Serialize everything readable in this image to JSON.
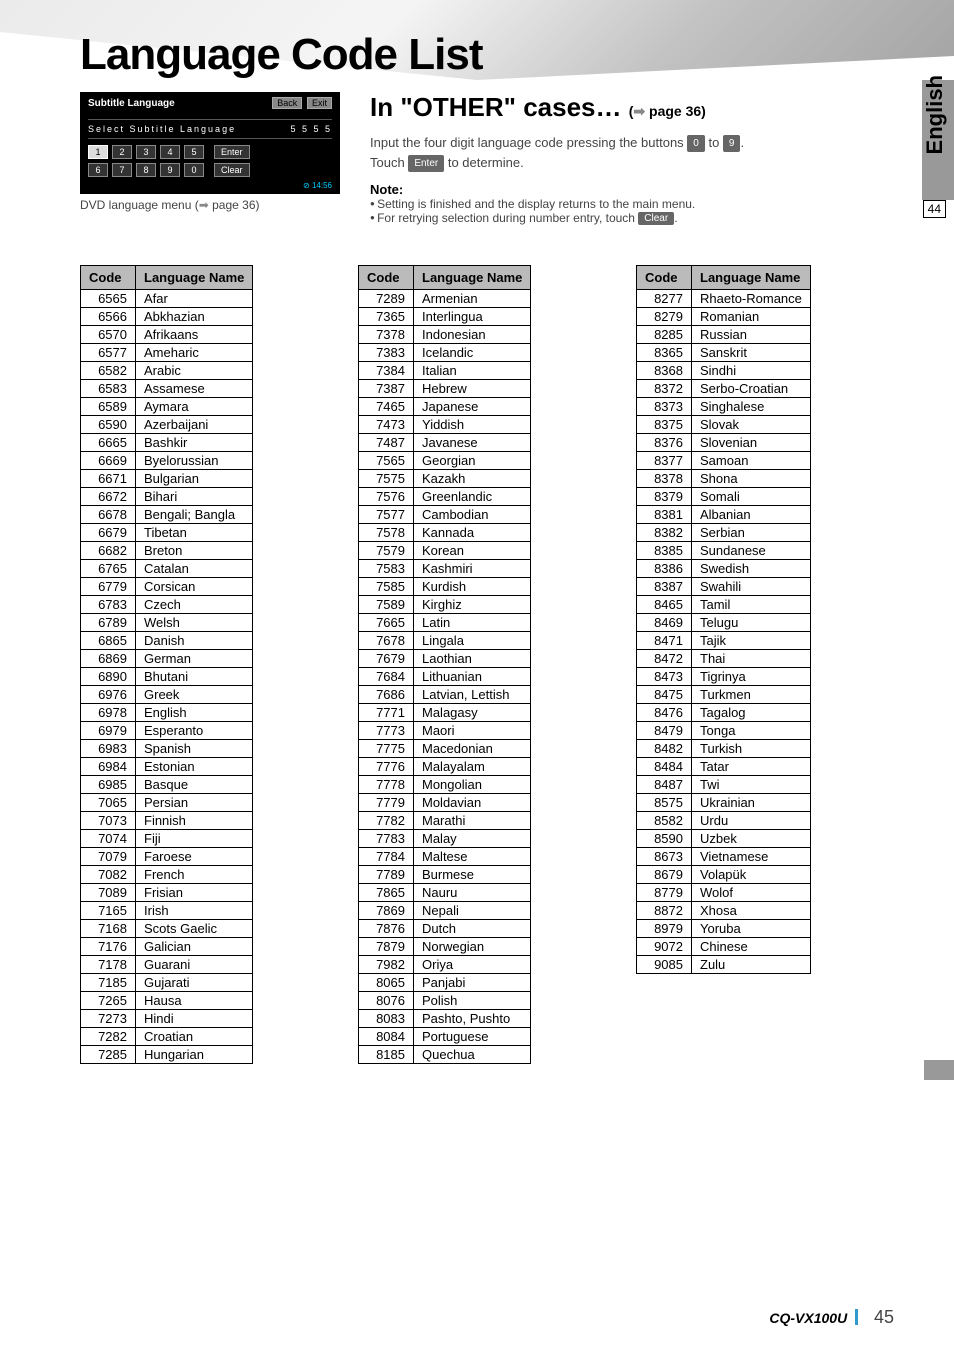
{
  "page_title": "Language Code List",
  "menu": {
    "title": "Subtitle Language",
    "back": "Back",
    "exit": "Exit",
    "select_label": "Select Subtitle Language",
    "display_code": "5 5 5 5",
    "row1": [
      "1",
      "2",
      "3",
      "4",
      "5"
    ],
    "row2": [
      "6",
      "7",
      "8",
      "9",
      "0"
    ],
    "enter": "Enter",
    "clear": "Clear",
    "clock": "⊘ 14:56"
  },
  "menu_caption_prefix": "DVD language menu (",
  "menu_caption_arrow": "➡",
  "menu_caption_suffix": " page 36)",
  "section": {
    "title_prefix": "In \"OTHER\" cases…",
    "page_ref_arrow": "➡",
    "page_ref": " page 36)",
    "line1_a": "Input the four digit language code pressing the buttons ",
    "btn0": "0",
    "line1_b": " to ",
    "btn9": "9",
    "line1_c": ".",
    "line2_a": "Touch ",
    "btn_enter": "Enter",
    "line2_b": " to determine.",
    "note_label": "Note:",
    "note1": "Setting is finished and the display returns to the main menu.",
    "note2_a": "For retrying selection during number entry, touch ",
    "btn_clear": "Clear",
    "note2_b": "."
  },
  "right_lang": "English",
  "right_page": "44",
  "headers": {
    "code": "Code",
    "name": "Language Name"
  },
  "table1": [
    [
      "6565",
      "Afar"
    ],
    [
      "6566",
      "Abkhazian"
    ],
    [
      "6570",
      "Afrikaans"
    ],
    [
      "6577",
      "Ameharic"
    ],
    [
      "6582",
      "Arabic"
    ],
    [
      "6583",
      "Assamese"
    ],
    [
      "6589",
      "Aymara"
    ],
    [
      "6590",
      "Azerbaijani"
    ],
    [
      "6665",
      "Bashkir"
    ],
    [
      "6669",
      "Byelorussian"
    ],
    [
      "6671",
      "Bulgarian"
    ],
    [
      "6672",
      "Bihari"
    ],
    [
      "6678",
      "Bengali; Bangla"
    ],
    [
      "6679",
      "Tibetan"
    ],
    [
      "6682",
      "Breton"
    ],
    [
      "6765",
      "Catalan"
    ],
    [
      "6779",
      "Corsican"
    ],
    [
      "6783",
      "Czech"
    ],
    [
      "6789",
      "Welsh"
    ],
    [
      "6865",
      "Danish"
    ],
    [
      "6869",
      "German"
    ],
    [
      "6890",
      "Bhutani"
    ],
    [
      "6976",
      "Greek"
    ],
    [
      "6978",
      "English"
    ],
    [
      "6979",
      "Esperanto"
    ],
    [
      "6983",
      "Spanish"
    ],
    [
      "6984",
      "Estonian"
    ],
    [
      "6985",
      "Basque"
    ],
    [
      "7065",
      "Persian"
    ],
    [
      "7073",
      "Finnish"
    ],
    [
      "7074",
      "Fiji"
    ],
    [
      "7079",
      "Faroese"
    ],
    [
      "7082",
      "French"
    ],
    [
      "7089",
      "Frisian"
    ],
    [
      "7165",
      "Irish"
    ],
    [
      "7168",
      "Scots Gaelic"
    ],
    [
      "7176",
      "Galician"
    ],
    [
      "7178",
      "Guarani"
    ],
    [
      "7185",
      "Gujarati"
    ],
    [
      "7265",
      "Hausa"
    ],
    [
      "7273",
      "Hindi"
    ],
    [
      "7282",
      "Croatian"
    ],
    [
      "7285",
      "Hungarian"
    ]
  ],
  "table2": [
    [
      "7289",
      "Armenian"
    ],
    [
      "7365",
      "Interlingua"
    ],
    [
      "7378",
      "Indonesian"
    ],
    [
      "7383",
      "Icelandic"
    ],
    [
      "7384",
      "Italian"
    ],
    [
      "7387",
      "Hebrew"
    ],
    [
      "7465",
      "Japanese"
    ],
    [
      "7473",
      "Yiddish"
    ],
    [
      "7487",
      "Javanese"
    ],
    [
      "7565",
      "Georgian"
    ],
    [
      "7575",
      "Kazakh"
    ],
    [
      "7576",
      "Greenlandic"
    ],
    [
      "7577",
      "Cambodian"
    ],
    [
      "7578",
      "Kannada"
    ],
    [
      "7579",
      "Korean"
    ],
    [
      "7583",
      "Kashmiri"
    ],
    [
      "7585",
      "Kurdish"
    ],
    [
      "7589",
      "Kirghiz"
    ],
    [
      "7665",
      "Latin"
    ],
    [
      "7678",
      "Lingala"
    ],
    [
      "7679",
      "Laothian"
    ],
    [
      "7684",
      "Lithuanian"
    ],
    [
      "7686",
      "Latvian, Lettish"
    ],
    [
      "7771",
      "Malagasy"
    ],
    [
      "7773",
      "Maori"
    ],
    [
      "7775",
      "Macedonian"
    ],
    [
      "7776",
      "Malayalam"
    ],
    [
      "7778",
      "Mongolian"
    ],
    [
      "7779",
      "Moldavian"
    ],
    [
      "7782",
      "Marathi"
    ],
    [
      "7783",
      "Malay"
    ],
    [
      "7784",
      "Maltese"
    ],
    [
      "7789",
      "Burmese"
    ],
    [
      "7865",
      "Nauru"
    ],
    [
      "7869",
      "Nepali"
    ],
    [
      "7876",
      "Dutch"
    ],
    [
      "7879",
      "Norwegian"
    ],
    [
      "7982",
      "Oriya"
    ],
    [
      "8065",
      "Panjabi"
    ],
    [
      "8076",
      "Polish"
    ],
    [
      "8083",
      "Pashto, Pushto"
    ],
    [
      "8084",
      "Portuguese"
    ],
    [
      "8185",
      "Quechua"
    ]
  ],
  "table3": [
    [
      "8277",
      "Rhaeto-Romance"
    ],
    [
      "8279",
      "Romanian"
    ],
    [
      "8285",
      "Russian"
    ],
    [
      "8365",
      "Sanskrit"
    ],
    [
      "8368",
      "Sindhi"
    ],
    [
      "8372",
      "Serbo-Croatian"
    ],
    [
      "8373",
      "Singhalese"
    ],
    [
      "8375",
      "Slovak"
    ],
    [
      "8376",
      "Slovenian"
    ],
    [
      "8377",
      "Samoan"
    ],
    [
      "8378",
      "Shona"
    ],
    [
      "8379",
      "Somali"
    ],
    [
      "8381",
      "Albanian"
    ],
    [
      "8382",
      "Serbian"
    ],
    [
      "8385",
      "Sundanese"
    ],
    [
      "8386",
      "Swedish"
    ],
    [
      "8387",
      "Swahili"
    ],
    [
      "8465",
      "Tamil"
    ],
    [
      "8469",
      "Telugu"
    ],
    [
      "8471",
      "Tajik"
    ],
    [
      "8472",
      "Thai"
    ],
    [
      "8473",
      "Tigrinya"
    ],
    [
      "8475",
      "Turkmen"
    ],
    [
      "8476",
      "Tagalog"
    ],
    [
      "8479",
      "Tonga"
    ],
    [
      "8482",
      "Turkish"
    ],
    [
      "8484",
      "Tatar"
    ],
    [
      "8487",
      "Twi"
    ],
    [
      "8575",
      "Ukrainian"
    ],
    [
      "8582",
      "Urdu"
    ],
    [
      "8590",
      "Uzbek"
    ],
    [
      "8673",
      "Vietnamese"
    ],
    [
      "8679",
      "Volapük"
    ],
    [
      "8779",
      "Wolof"
    ],
    [
      "8872",
      "Xhosa"
    ],
    [
      "8979",
      "Yoruba"
    ],
    [
      "9072",
      "Chinese"
    ],
    [
      "9085",
      "Zulu"
    ]
  ],
  "footer": {
    "model": "CQ-VX100U",
    "page": "45"
  }
}
